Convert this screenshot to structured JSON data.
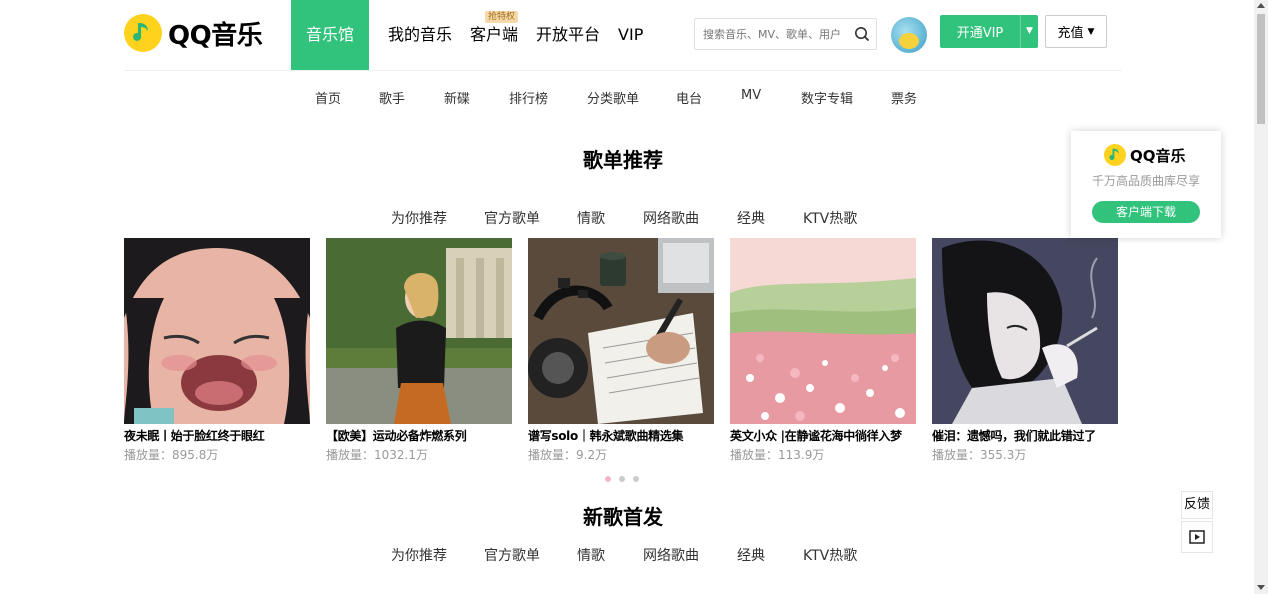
{
  "brand": {
    "name": "QQ音乐",
    "logo_icon": "qq-music-logo-icon",
    "color": "#31c27c",
    "logo_color": "#ffd21e"
  },
  "header": {
    "nav": [
      {
        "label": "音乐馆",
        "active": true
      },
      {
        "label": "我的音乐"
      },
      {
        "label": "客户端",
        "badge": "抢特权"
      },
      {
        "label": "开放平台"
      },
      {
        "label": "VIP"
      }
    ],
    "search": {
      "placeholder": "搜索音乐、MV、歌单、用户",
      "icon": "search-icon"
    },
    "vip_button": "开通VIP",
    "recharge_button": "充值"
  },
  "subnav": [
    "首页",
    "歌手",
    "新碟",
    "排行榜",
    "分类歌单",
    "电台",
    "MV",
    "数字专辑",
    "票务"
  ],
  "playlist_section": {
    "title": "歌单推荐",
    "tabs": [
      "为你推荐",
      "官方歌单",
      "情歌",
      "网络歌曲",
      "经典",
      "KTV热歌"
    ],
    "cards": [
      {
        "title": "夜未眠丨始于脸红终于眼红",
        "plays": "播放量：895.8万"
      },
      {
        "title": "【欧美】运动必备炸燃系列",
        "plays": "播放量：1032.1万"
      },
      {
        "title": "谱写solo｜韩永斌歌曲精选集",
        "plays": "播放量：9.2万"
      },
      {
        "title": "英文小众 |在静谧花海中徜徉入梦",
        "plays": "播放量：113.9万"
      },
      {
        "title": "催泪：遗憾吗，我们就此错过了",
        "plays": "播放量：355.3万"
      }
    ]
  },
  "new_songs_section": {
    "title": "新歌首发",
    "tabs": [
      "为你推荐",
      "官方歌单",
      "情歌",
      "网络歌曲",
      "经典",
      "KTV热歌"
    ]
  },
  "download_panel": {
    "brand": "QQ音乐",
    "slogan": "千万高品质曲库尽享",
    "button": "客户端下载"
  },
  "side_tools": {
    "feedback": "反馈",
    "video_icon": "play-video-icon"
  }
}
